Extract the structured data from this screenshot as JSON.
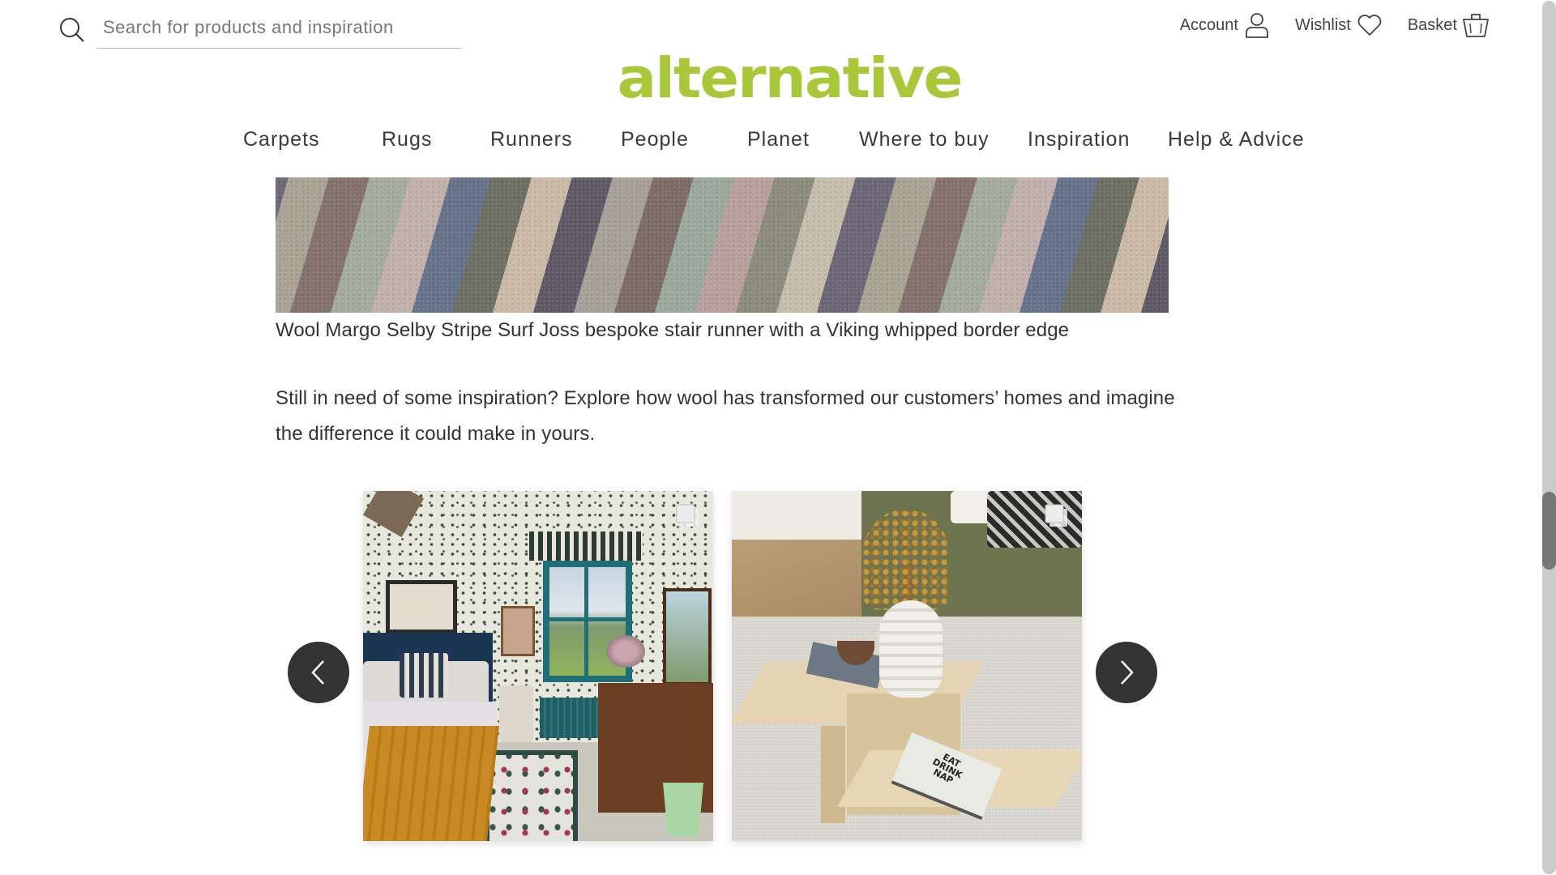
{
  "header": {
    "search": {
      "placeholder": "Search for products and inspiration",
      "value": "",
      "icon": "search-icon"
    },
    "utility": [
      {
        "label": "Account",
        "icon": "user-icon"
      },
      {
        "label": "Wishlist",
        "icon": "heart-icon"
      },
      {
        "label": "Basket",
        "icon": "basket-icon"
      }
    ],
    "logo": {
      "text": "alternative",
      "color": "#a8c83a"
    },
    "nav": [
      {
        "label": "Carpets"
      },
      {
        "label": "Rugs"
      },
      {
        "label": "Runners"
      },
      {
        "label": "People"
      },
      {
        "label": "Planet"
      },
      {
        "label": "Where to buy"
      },
      {
        "label": "Inspiration"
      },
      {
        "label": "Help & Advice"
      }
    ]
  },
  "content": {
    "hero_image": {
      "alt": "Striped stair runner in muted multicolour wool"
    },
    "caption": "Wool Margo Selby Stripe Surf Joss bespoke stair runner with a Viking whipped border edge",
    "intro": "Still in need of some inspiration? Explore how wool has transformed our customers’ homes and imagine the difference it could make in yours.",
    "carousel": {
      "prev_icon": "chevron-left-icon",
      "next_icon": "chevron-right-icon",
      "slides": [
        {
          "alt": "Patterned bedroom with mustard quilted throw and floral rug",
          "badge_icon": "multiple-images-icon"
        },
        {
          "alt": "Travertine coffee table with sculptural vase and Eat Drink Nap book",
          "badge_icon": "multiple-images-icon",
          "book_text": "EAT DRINK NAP"
        }
      ]
    }
  },
  "colors": {
    "text": "#333333",
    "brand": "#a8c83a",
    "arrow_bg": "#333333",
    "scroll_thumb": "#777777",
    "scroll_track": "#cbcbcb"
  },
  "scroll": {
    "position_fraction": 0.62
  }
}
